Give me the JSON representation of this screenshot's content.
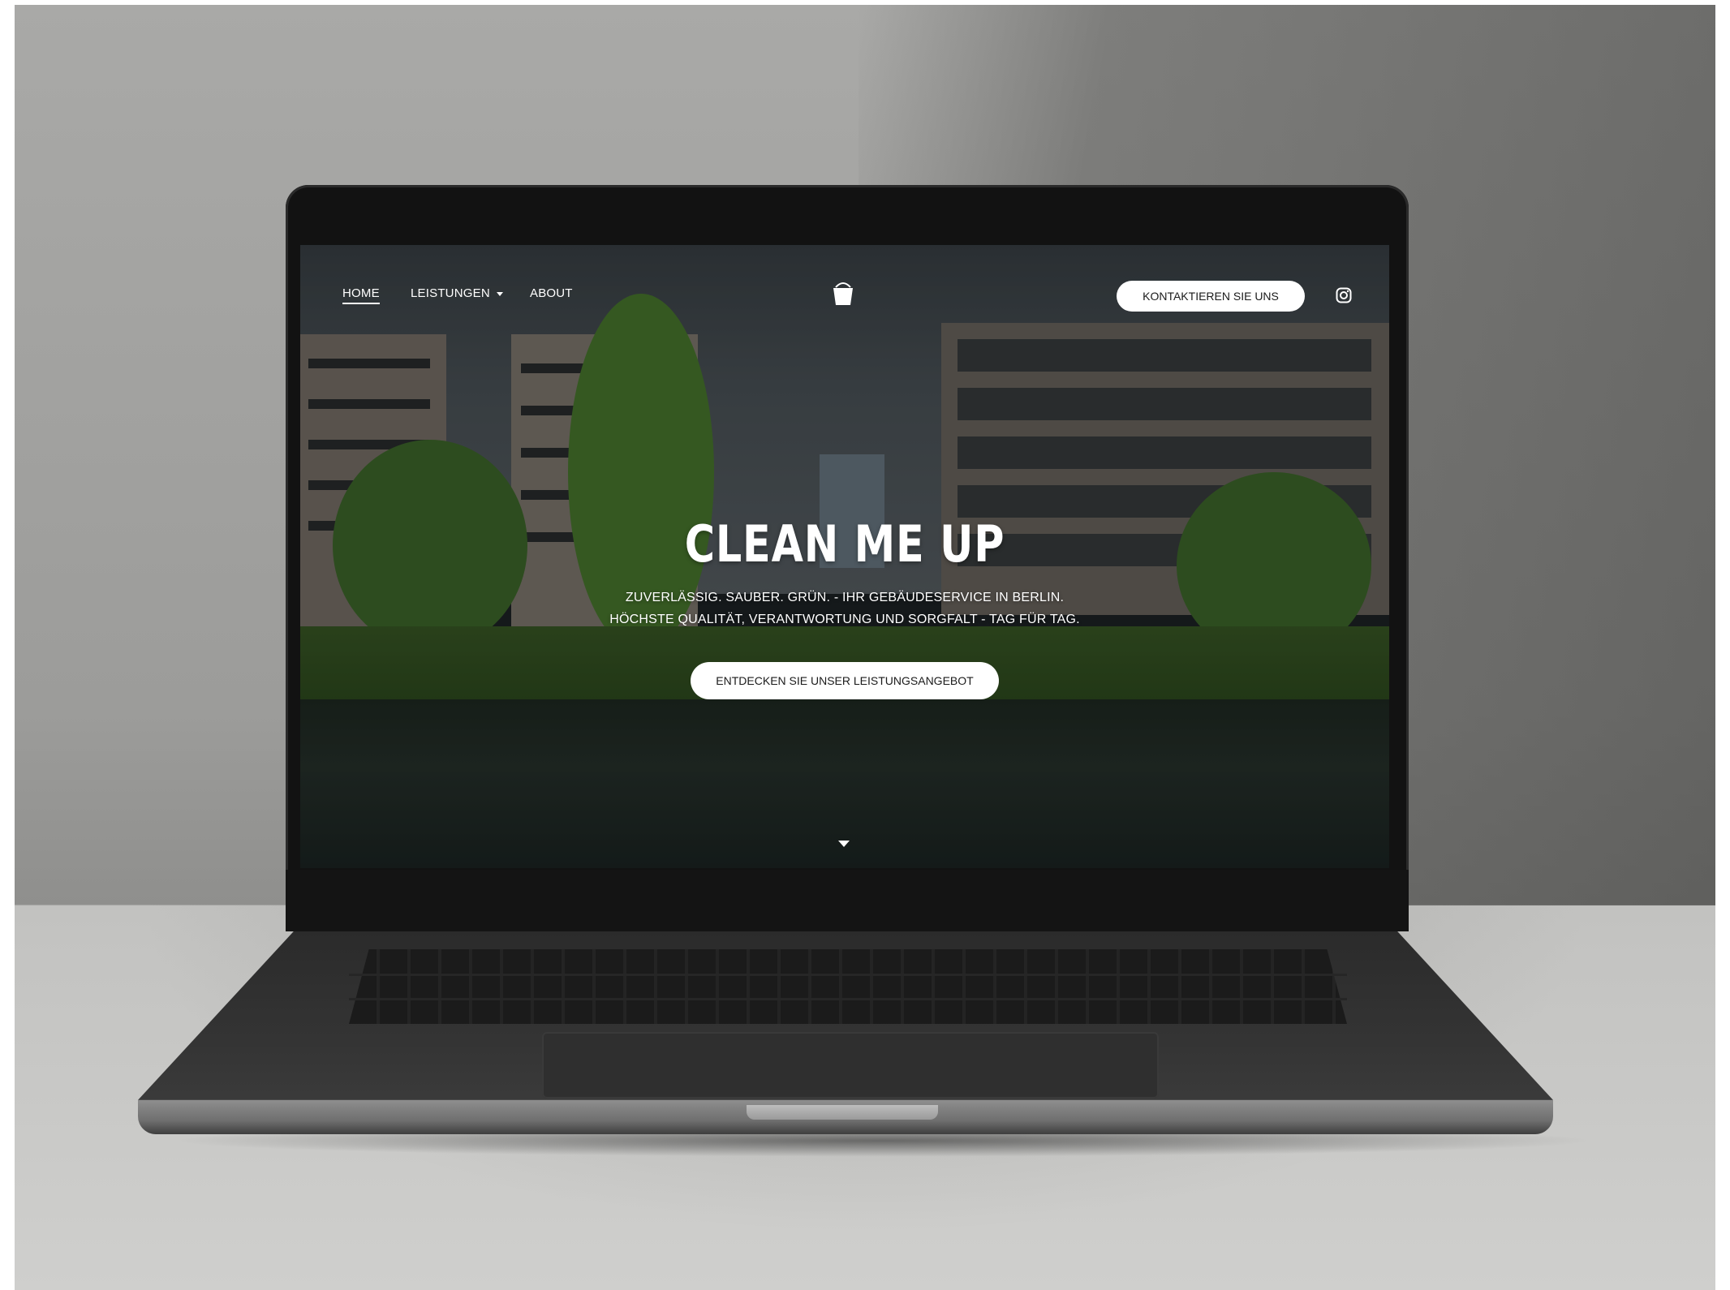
{
  "nav": {
    "items": [
      {
        "label": "HOME",
        "active": true
      },
      {
        "label": "LEISTUNGEN",
        "has_dropdown": true
      },
      {
        "label": "ABOUT"
      }
    ],
    "logo_icon": "bucket-icon",
    "contact_button": "KONTAKTIEREN SIE UNS",
    "social_icon": "instagram-icon"
  },
  "hero": {
    "title": "CLEAN ME UP",
    "subtitle_line1": "ZUVERLÄSSIG. SAUBER. GRÜN. - IHR GEBÄUDESERVICE IN BERLIN.",
    "subtitle_line2": "HÖCHSTE QUALITÄT, VERANTWORTUNG UND SORGFALT - TAG FÜR TAG.",
    "cta_button": "ENTDECKEN SIE UNSER LEISTUNGSANGEBOT",
    "scroll_icon": "chevron-down-icon"
  },
  "colors": {
    "button_bg": "#ffffff",
    "button_text": "#1b1b1b",
    "text": "#ffffff"
  }
}
